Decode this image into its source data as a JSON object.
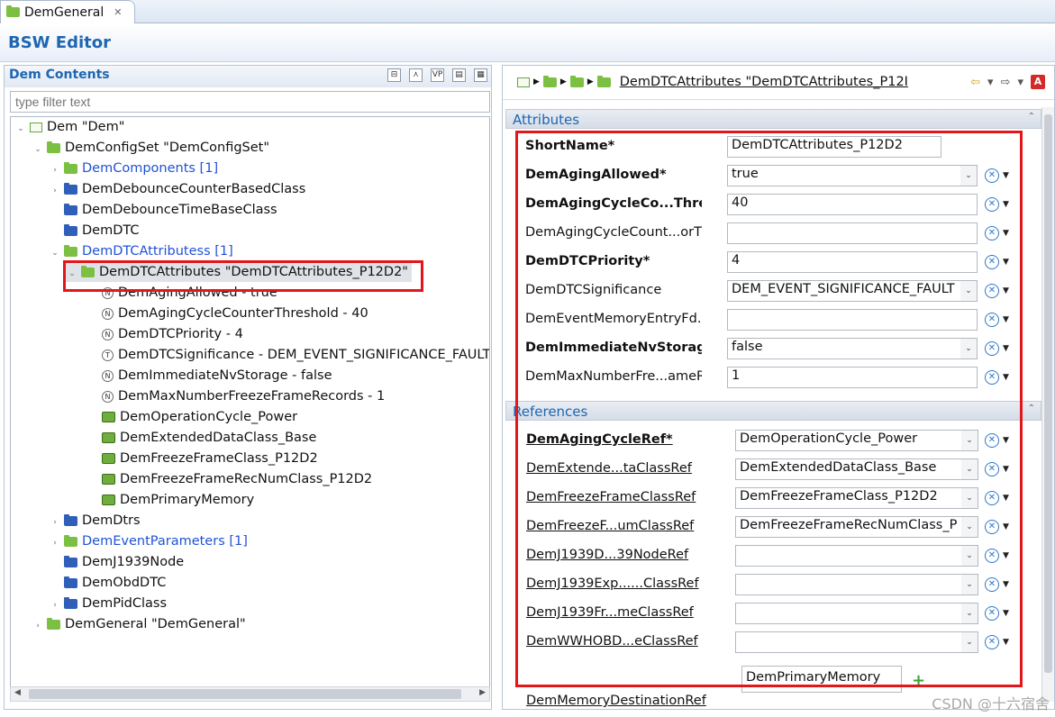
{
  "tab": {
    "title": "DemGeneral",
    "close": "✕"
  },
  "editor_title": "BSW Editor",
  "left": {
    "title": "Dem Contents",
    "filter_placeholder": "type filter text",
    "tools": [
      "⊟",
      "⋏",
      "VP",
      "▤",
      "▦"
    ],
    "tree": [
      {
        "label": "Dem \"Dem\"",
        "tw": "⌄",
        "icon": "box"
      },
      {
        "label": "DemConfigSet \"DemConfigSet\"",
        "tw": "⌄",
        "icon": "fg"
      },
      {
        "label": "DemComponents [1]",
        "tw": "›",
        "icon": "fg",
        "blue": true
      },
      {
        "label": "DemDebounceCounterBasedClass",
        "tw": "›",
        "icon": "fb"
      },
      {
        "label": "DemDebounceTimeBaseClass",
        "tw": "",
        "icon": "fb"
      },
      {
        "label": "DemDTC",
        "tw": "",
        "icon": "fb"
      },
      {
        "label": "DemDTCAttributess [1]",
        "tw": "⌄",
        "icon": "fg",
        "blue": true
      },
      {
        "label": "DemDTCAttributes \"DemDTCAttributes_P12D2\"",
        "tw": "⌄",
        "icon": "fg",
        "sel": true
      },
      {
        "label": "DemAgingAllowed - true",
        "icon": "N"
      },
      {
        "label": "DemAgingCycleCounterThreshold - 40",
        "icon": "N"
      },
      {
        "label": "DemDTCPriority - 4",
        "icon": "N"
      },
      {
        "label": "DemDTCSignificance - DEM_EVENT_SIGNIFICANCE_FAULT",
        "icon": "T"
      },
      {
        "label": "DemImmediateNvStorage - false",
        "icon": "N"
      },
      {
        "label": "DemMaxNumberFreezeFrameRecords - 1",
        "icon": "N"
      },
      {
        "label": "DemOperationCycle_Power",
        "icon": "R"
      },
      {
        "label": "DemExtendedDataClass_Base",
        "icon": "R"
      },
      {
        "label": "DemFreezeFrameClass_P12D2",
        "icon": "R"
      },
      {
        "label": "DemFreezeFrameRecNumClass_P12D2",
        "icon": "R"
      },
      {
        "label": "DemPrimaryMemory",
        "icon": "R"
      },
      {
        "label": "DemDtrs",
        "tw": "›",
        "icon": "fb"
      },
      {
        "label": "DemEventParameters [1]",
        "tw": "›",
        "icon": "fg",
        "blue": true
      },
      {
        "label": "DemJ1939Node",
        "tw": "",
        "icon": "fb"
      },
      {
        "label": "DemObdDTC",
        "tw": "",
        "icon": "fb"
      },
      {
        "label": "DemPidClass",
        "tw": "›",
        "icon": "fb"
      },
      {
        "label": "DemGeneral \"DemGeneral\"",
        "tw": "›",
        "icon": "fg"
      }
    ]
  },
  "right": {
    "breadcrumb": "DemDTCAttributes \"DemDTCAttributes_P12I",
    "nav": [
      "⇦",
      "▾",
      "⇨",
      "▾",
      "A"
    ],
    "attributes_title": "Attributes",
    "references_title": "References",
    "collapse": "⌃",
    "attributes": [
      {
        "label": "ShortName*",
        "bold": true,
        "value": "DemDTCAttributes_P12D2",
        "kind": "text",
        "short": true
      },
      {
        "label": "DemAgingAllowed*",
        "bold": true,
        "value": "true",
        "kind": "combo"
      },
      {
        "label": "DemAgingCycleCo...Threshold",
        "bold": true,
        "value": "40",
        "kind": "text"
      },
      {
        "label": "DemAgingCycleCount...orThreshold",
        "bold": false,
        "value": "",
        "kind": "text"
      },
      {
        "label": "DemDTCPriority*",
        "bold": true,
        "value": "4",
        "kind": "text"
      },
      {
        "label": "DemDTCSignificance",
        "bold": false,
        "value": "DEM_EVENT_SIGNIFICANCE_FAULT",
        "kind": "combo"
      },
      {
        "label": "DemEventMemoryEntryFd...",
        "bold": false,
        "value": "",
        "kind": "text"
      },
      {
        "label": "DemImmediateNvStorage",
        "bold": true,
        "value": "false",
        "kind": "combo"
      },
      {
        "label": "DemMaxNumberFre...ameRecords",
        "bold": false,
        "value": "1",
        "kind": "text"
      }
    ],
    "references": [
      {
        "label": "DemAgingCycleRef*",
        "bold": true,
        "value": "DemOperationCycle_Power"
      },
      {
        "label": "DemExtende...taClassRef",
        "bold": false,
        "value": "DemExtendedDataClass_Base"
      },
      {
        "label": "DemFreezeFrameClassRef",
        "bold": false,
        "value": "DemFreezeFrameClass_P12D2"
      },
      {
        "label": "DemFreezeF...umClassRef",
        "bold": false,
        "value": "DemFreezeFrameRecNumClass_P"
      },
      {
        "label": "DemJ1939D...39NodeRef",
        "bold": false,
        "value": ""
      },
      {
        "label": "DemJ1939Exp......ClassRef",
        "bold": false,
        "value": ""
      },
      {
        "label": "DemJ1939Fr...meClassRef",
        "bold": false,
        "value": ""
      },
      {
        "label": "DemWWHOBD...eClassRef",
        "bold": false,
        "value": ""
      }
    ],
    "memory_dest": {
      "label": "DemMemoryDestinationRef",
      "value": "DemPrimaryMemory",
      "add": "+"
    }
  },
  "watermark": "CSDN @十六宿舍",
  "colors": {
    "accent": "#1d66b1",
    "highlight": "#e3161a",
    "link": "#1f52d6"
  }
}
